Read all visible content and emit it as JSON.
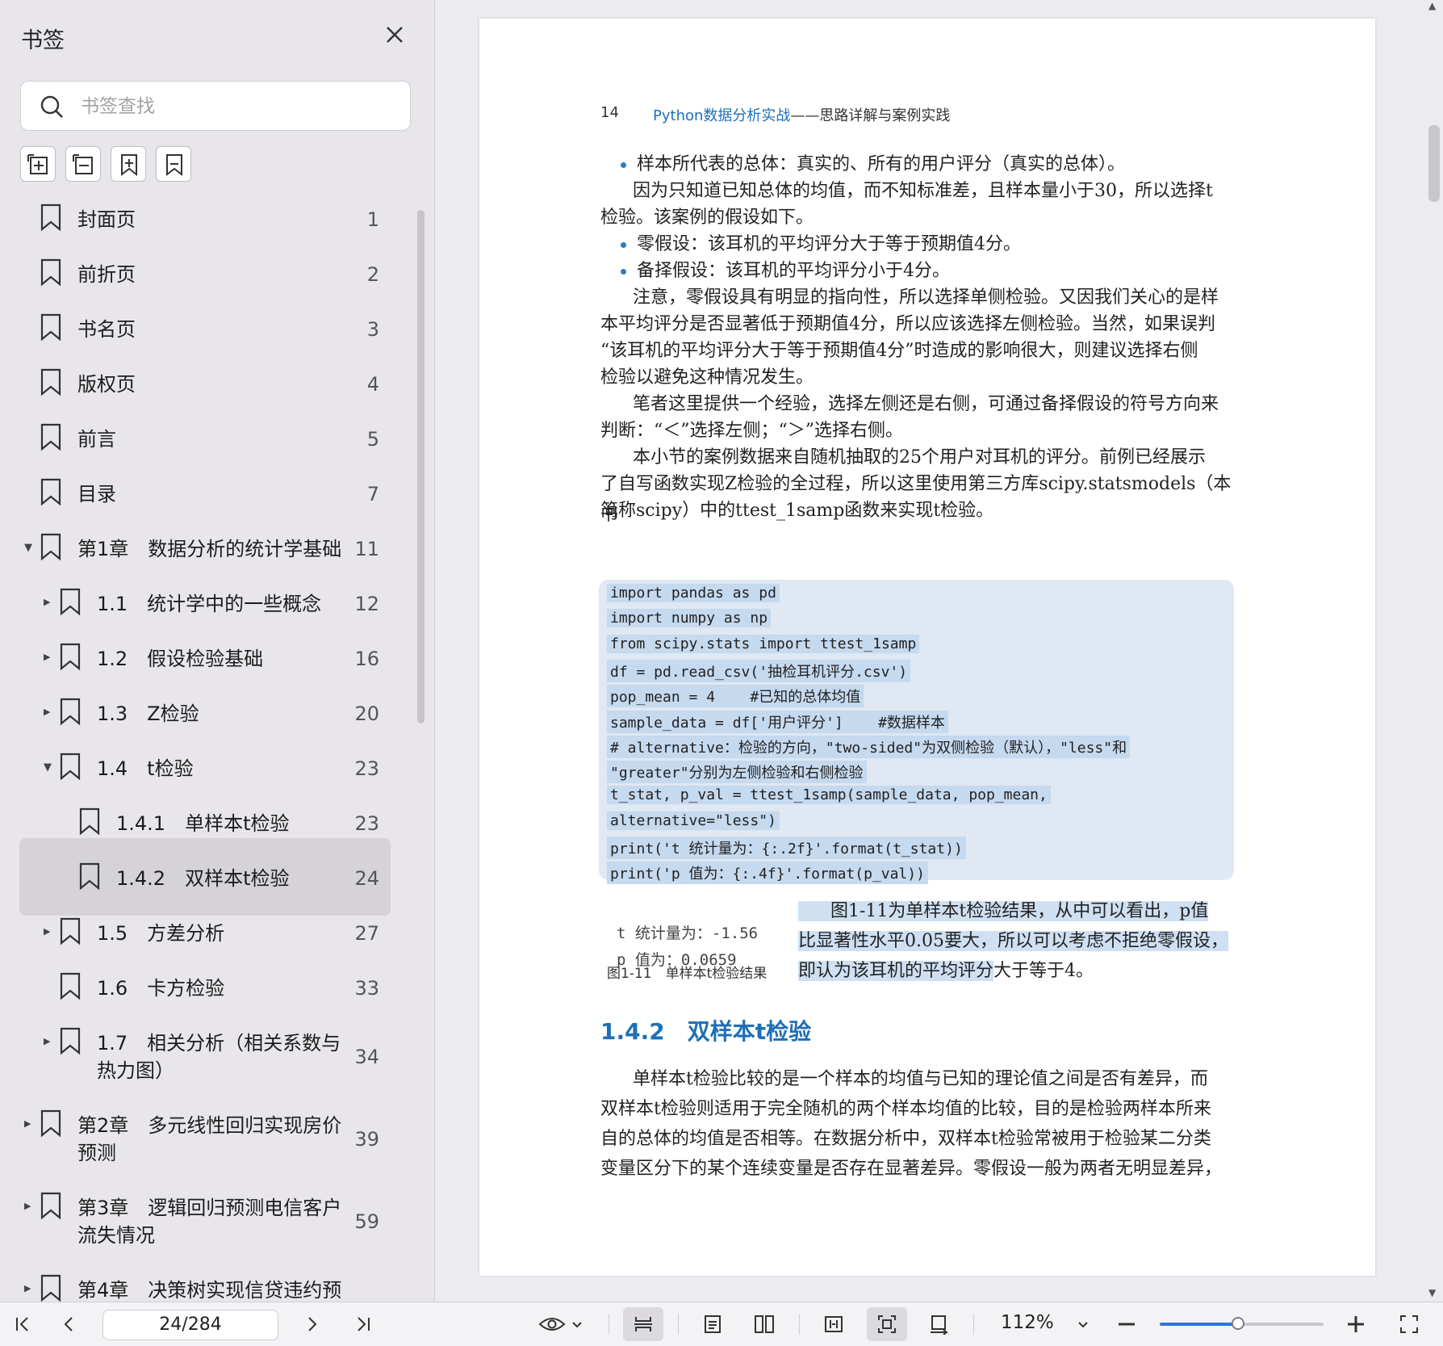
{
  "sidebar": {
    "title": "书签",
    "search_placeholder": "书签查找",
    "bookmarks": [
      {
        "label": "封面页",
        "page": "1",
        "level": 0,
        "arrow": ""
      },
      {
        "label": "前折页",
        "page": "2",
        "level": 0,
        "arrow": ""
      },
      {
        "label": "书名页",
        "page": "3",
        "level": 0,
        "arrow": ""
      },
      {
        "label": "版权页",
        "page": "4",
        "level": 0,
        "arrow": ""
      },
      {
        "label": "前言",
        "page": "5",
        "level": 0,
        "arrow": ""
      },
      {
        "label": "目录",
        "page": "7",
        "level": 0,
        "arrow": ""
      },
      {
        "label": "第1章　数据分析的统计学基础",
        "page": "11",
        "level": 0,
        "arrow": "down"
      },
      {
        "label": "1.1　统计学中的一些概念",
        "page": "12",
        "level": 1,
        "arrow": "right"
      },
      {
        "label": "1.2　假设检验基础",
        "page": "16",
        "level": 1,
        "arrow": "right"
      },
      {
        "label": "1.3　Z检验",
        "page": "20",
        "level": 1,
        "arrow": "right"
      },
      {
        "label": "1.4　t检验",
        "page": "23",
        "level": 1,
        "arrow": "down"
      },
      {
        "label": "1.4.1　单样本t检验",
        "page": "23",
        "level": 2,
        "arrow": ""
      },
      {
        "label": "1.4.2　双样本t检验",
        "page": "24",
        "level": 2,
        "arrow": "",
        "selected": true
      },
      {
        "label": "1.5　方差分析",
        "page": "27",
        "level": 1,
        "arrow": "right"
      },
      {
        "label": "1.6　卡方检验",
        "page": "33",
        "level": 1,
        "arrow": ""
      },
      {
        "label": "1.7　相关分析（相关系数与\n热力图）",
        "page": "34",
        "level": 1,
        "arrow": "right"
      },
      {
        "label": "第2章　多元线性回归实现房价\n预测",
        "page": "39",
        "level": 0,
        "arrow": "right"
      },
      {
        "label": "第3章　逻辑回归预测电信客户\n流失情况",
        "page": "59",
        "level": 0,
        "arrow": "right"
      },
      {
        "label": "第4章　决策树实现信贷违约预",
        "page": "",
        "level": 0,
        "arrow": "right"
      }
    ]
  },
  "page": {
    "number": "14",
    "header_title_blue": "Python数据分析实战",
    "header_title_rest": "——思路详解与案例实践",
    "bullet1": "样本所代表的总体：真实的、所有的用户评分（真实的总体）。",
    "para1_l1": "因为只知道已知总体的均值，而不知标准差，且样本量小于30，所以选择t",
    "para1_l2": "检验。该案例的假设如下。",
    "bullet2": "零假设：该耳机的平均评分大于等于预期值4分。",
    "bullet3": "备择假设：该耳机的平均评分小于4分。",
    "para2_l1": "注意，零假设具有明显的指向性，所以选择单侧检验。又因我们关心的是样",
    "para2_l2": "本平均评分是否显著低于预期值4分，所以应该选择左侧检验。当然，如果误判",
    "para2_l3": "“该耳机的平均评分大于等于预期值4分”时造成的影响很大，则建议选择右侧",
    "para2_l4": "检验以避免这种情况发生。",
    "para3_l1": "笔者这里提供一个经验，选择左侧还是右侧，可通过备择假设的符号方向来",
    "para3_l2": "判断：“＜”选择左侧；“＞”选择右侧。",
    "para4_l1": "本小节的案例数据来自随机抽取的25个用户对耳机的评分。前例已经展示",
    "para4_l2": "了自写函数实现Z检验的全过程，所以这里使用第三方库scipy.statsmodels（本书",
    "para4_l3": "简称scipy）中的ttest_1samp函数来实现t检验。",
    "code": [
      "import pandas as pd",
      "import numpy as np",
      "from scipy.stats import ttest_1samp",
      "df = pd.read_csv('抽检耳机评分.csv')",
      "pop_mean = 4    #已知的总体均值",
      "sample_data = df['用户评分']    #数据样本",
      "# alternative：检验的方向，\"two-sided\"为双侧检验（默认），\"less\"和",
      "\"greater\"分别为左侧检验和右侧检验",
      "t_stat, p_val = ttest_1samp(sample_data, pop_mean,",
      "alternative=\"less\")",
      "print('t 统计量为：{:.2f}'.format(t_stat))",
      "print('p 值为：{:.4f}'.format(p_val))"
    ],
    "fig_out1": "t 统计量为：-1.56",
    "fig_out2": "p 值为：0.0659",
    "fig_caption": "图1-11　单样本t检验结果",
    "fig_text_l1": "图1-11为单样本t检验结果，从中可以看出，p值",
    "fig_text_l2": "比显著性水平0.05要大，所以可以考虑不拒绝零假设，",
    "fig_text_l3a": "即认为该耳机的平均评分",
    "fig_text_l3b": "大于等于4。",
    "section_title": "1.4.2　双样本t检验",
    "para5_l1": "单样本t检验比较的是一个样本的均值与已知的理论值之间是否有差异，而",
    "para5_l2": "双样本t检验则适用于完全随机的两个样本均值的比较，目的是检验两样本所来",
    "para5_l3": "自的总体的均值是否相等。在数据分析中，双样本t检验常被用于检验某二分类",
    "para5_l4": "变量区分下的某个连续变量是否存在显著差异。零假设一般为两者无明显差异，"
  },
  "toolbar": {
    "page_indicator": "24/284",
    "zoom": "112%",
    "zoom_fraction": 0.48,
    "accent": "#2e77d0"
  }
}
